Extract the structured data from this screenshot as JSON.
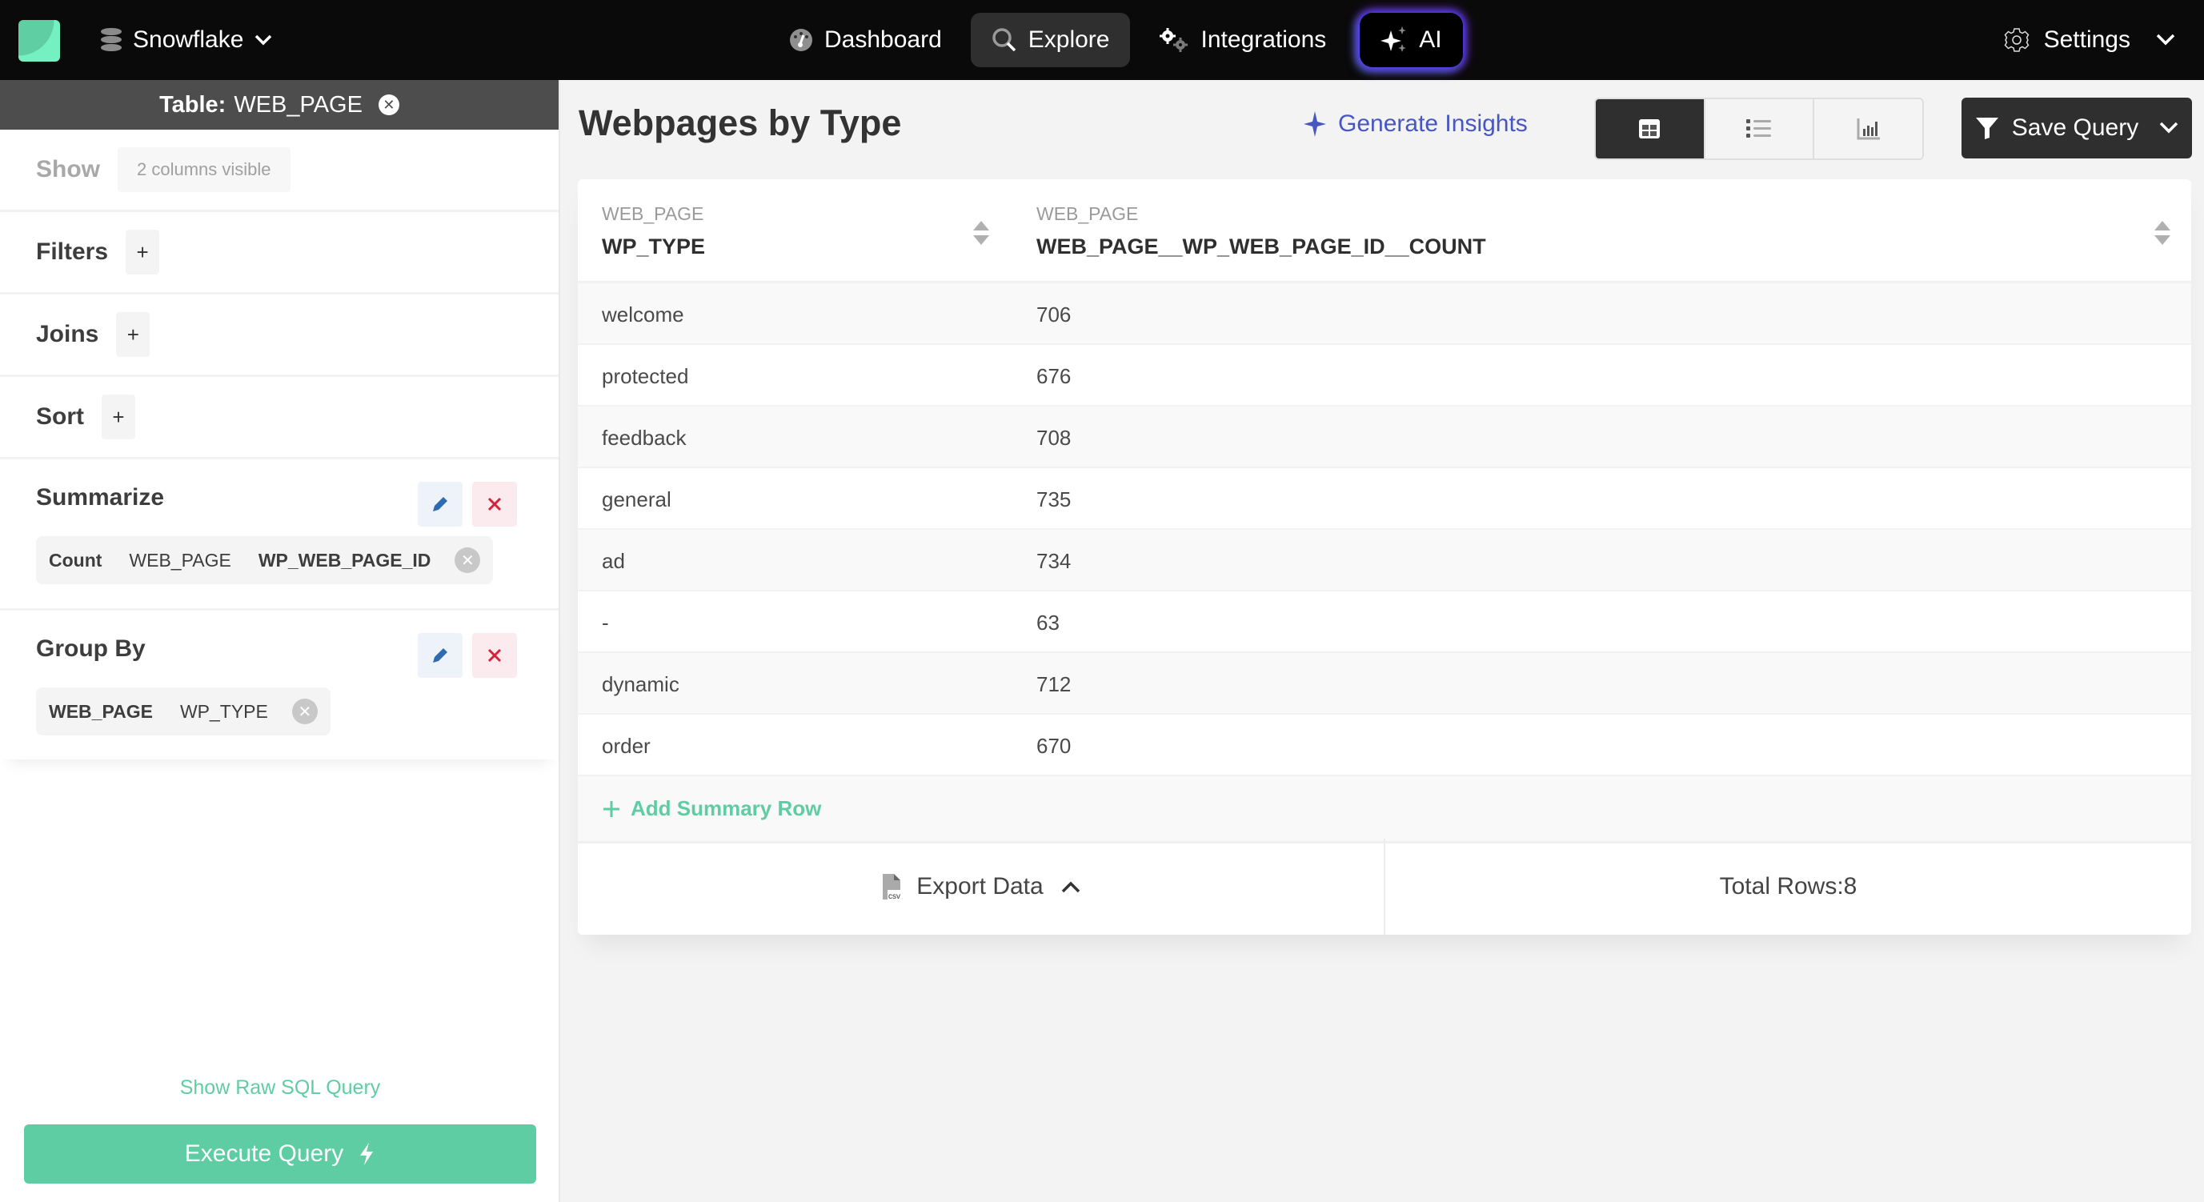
{
  "nav": {
    "db_name": "Snowflake",
    "items": [
      {
        "label": "Dashboard",
        "icon": "gauge-icon",
        "active": false
      },
      {
        "label": "Explore",
        "icon": "search-icon",
        "active": true
      },
      {
        "label": "Integrations",
        "icon": "gears-icon",
        "active": false
      },
      {
        "label": "AI",
        "icon": "sparkle-icon",
        "active": false
      }
    ],
    "settings_label": "Settings"
  },
  "sidebar": {
    "table_label": "Table:",
    "table_name": "WEB_PAGE",
    "show": {
      "title": "Show",
      "value": "2 columns visible"
    },
    "filters": {
      "title": "Filters",
      "add": "+"
    },
    "joins": {
      "title": "Joins",
      "add": "+"
    },
    "sort": {
      "title": "Sort",
      "add": "+"
    },
    "summarize": {
      "title": "Summarize",
      "chip": {
        "func": "Count",
        "table": "WEB_PAGE",
        "column": "WP_WEB_PAGE_ID"
      }
    },
    "group_by": {
      "title": "Group By",
      "chip": {
        "table": "WEB_PAGE",
        "column": "WP_TYPE"
      }
    },
    "show_raw_sql": "Show Raw SQL Query",
    "execute_label": "Execute Query"
  },
  "main": {
    "title": "Webpages by Type",
    "generate_insights": "Generate Insights",
    "view_modes": [
      "table",
      "list",
      "chart"
    ],
    "active_view": "table",
    "save_query": "Save Query",
    "table": {
      "columns": [
        {
          "table": "WEB_PAGE",
          "name": "WP_TYPE"
        },
        {
          "table": "WEB_PAGE",
          "name": "WEB_PAGE__WP_WEB_PAGE_ID__COUNT"
        }
      ],
      "rows": [
        [
          "welcome",
          "706"
        ],
        [
          "protected",
          "676"
        ],
        [
          "feedback",
          "708"
        ],
        [
          "general",
          "735"
        ],
        [
          "ad",
          "734"
        ],
        [
          "-",
          "63"
        ],
        [
          "dynamic",
          "712"
        ],
        [
          "order",
          "670"
        ]
      ],
      "add_summary_row": "Add Summary Row"
    },
    "export_label": "Export Data",
    "total_rows": "Total Rows:8"
  },
  "colors": {
    "accent_green": "#5ecda3",
    "insights_blue": "#4757c0",
    "nav_bg": "#0a0a0a",
    "dark_button": "#2f2f2f",
    "delete_red": "#d2233a",
    "edit_blue": "#2f6bb0"
  }
}
